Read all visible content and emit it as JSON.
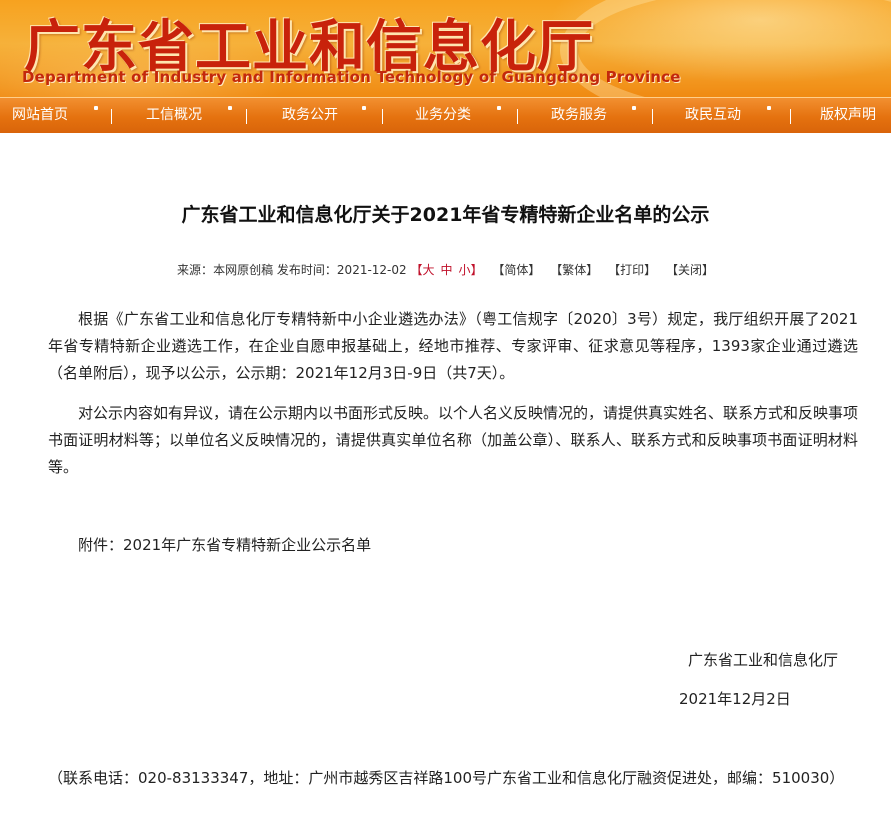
{
  "header": {
    "title": "广东省工业和信息化厅",
    "subtitle": "Department of Industry and Information Technology of Guangdong Province"
  },
  "nav": {
    "items": [
      "网站首页",
      "工信概况",
      "政务公开",
      "业务分类",
      "政务服务",
      "政民互动",
      "版权声明"
    ]
  },
  "article": {
    "title": "广东省工业和信息化厅关于2021年省专精特新企业名单的公示",
    "meta": {
      "source_label": "来源：",
      "source": "本网原创稿",
      "publish_label": "发布时间：",
      "publish_time": "2021-12-02",
      "font_open": "【",
      "font_large": "大",
      "font_medium": "中",
      "font_small": "小",
      "font_close": "】",
      "simplified": "【简体】",
      "traditional": "【繁体】",
      "print": "【打印】",
      "close": "【关闭】"
    },
    "paragraphs": [
      "根据《广东省工业和信息化厅专精特新中小企业遴选办法》（粤工信规字〔2020〕3号）规定，我厅组织开展了2021年省专精特新企业遴选工作，在企业自愿申报基础上，经地市推荐、专家评审、征求意见等程序，1393家企业通过遴选（名单附后），现予以公示，公示期：2021年12月3日-9日（共7天）。",
      "对公示内容如有异议，请在公示期内以书面形式反映。以个人名义反映情况的，请提供真实姓名、联系方式和反映事项书面证明材料等；以单位名义反映情况的，请提供真实单位名称（加盖公章）、联系人、联系方式和反映事项书面证明材料等。"
    ],
    "attachment": "附件：2021年广东省专精特新企业公示名单",
    "signature_org": "广东省工业和信息化厅",
    "signature_date": "2021年12月2日",
    "contact": "（联系电话：020-83133347，地址：广州市越秀区吉祥路100号广东省工业和信息化厅融资促进处，邮编：510030）"
  }
}
